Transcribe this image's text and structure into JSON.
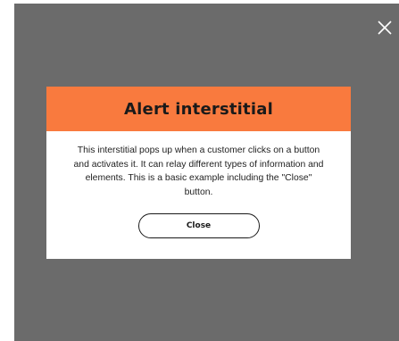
{
  "overlay": {
    "close_icon": "close-icon"
  },
  "modal": {
    "title": "Alert interstitial",
    "body": "This interstitial pops up when a customer clicks on a button and activates it. It can relay different types of information and elements. This is a basic example including the \"Close\" button.",
    "close_label": "Close"
  },
  "colors": {
    "overlay": "#6b6b6b",
    "header_accent": "#f97a3e",
    "modal_background": "#ffffff",
    "text": "#1a1a1a"
  }
}
